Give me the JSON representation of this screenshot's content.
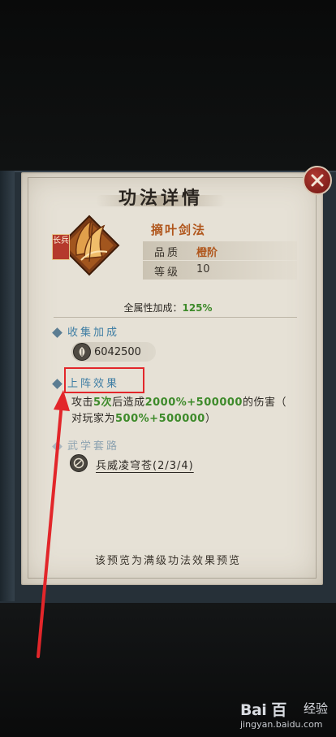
{
  "dialog": {
    "title": "功法详情",
    "close_icon": "close-icon",
    "skill": {
      "icon": "sword-leaf-skill-icon",
      "badge": "长兵",
      "name": "摘叶剑法",
      "quality_label": "品质",
      "quality_value": "橙阶",
      "level_label": "等级",
      "level_value": "10"
    },
    "attribute_bonus": {
      "label": "全属性加成：",
      "value": "125%"
    },
    "collection": {
      "title": "收集加成",
      "coin_icon": "seed-coin-icon",
      "value": "6042500"
    },
    "deploy_effect": {
      "title": "上阵效果",
      "line1_parts": [
        "攻击",
        "5次",
        "后造成",
        "2000%+500000",
        "的伤害（"
      ],
      "line2_parts": [
        "对玩家为",
        "500%+500000",
        "）"
      ]
    },
    "martial_set": {
      "title": "武学套路",
      "icon": "set-emblem-icon",
      "name": "兵威凌穹苍(2/3/4)"
    },
    "footnote": "该预览为满级功法效果预览"
  },
  "watermark": {
    "logo": "Bai 百",
    "text": "经验",
    "url": "jingyan.baidu.com"
  },
  "colors": {
    "orange": "#b0561c",
    "green": "#3d8a2a",
    "blue": "#3f7ea4",
    "annotation_red": "#e2262a"
  }
}
